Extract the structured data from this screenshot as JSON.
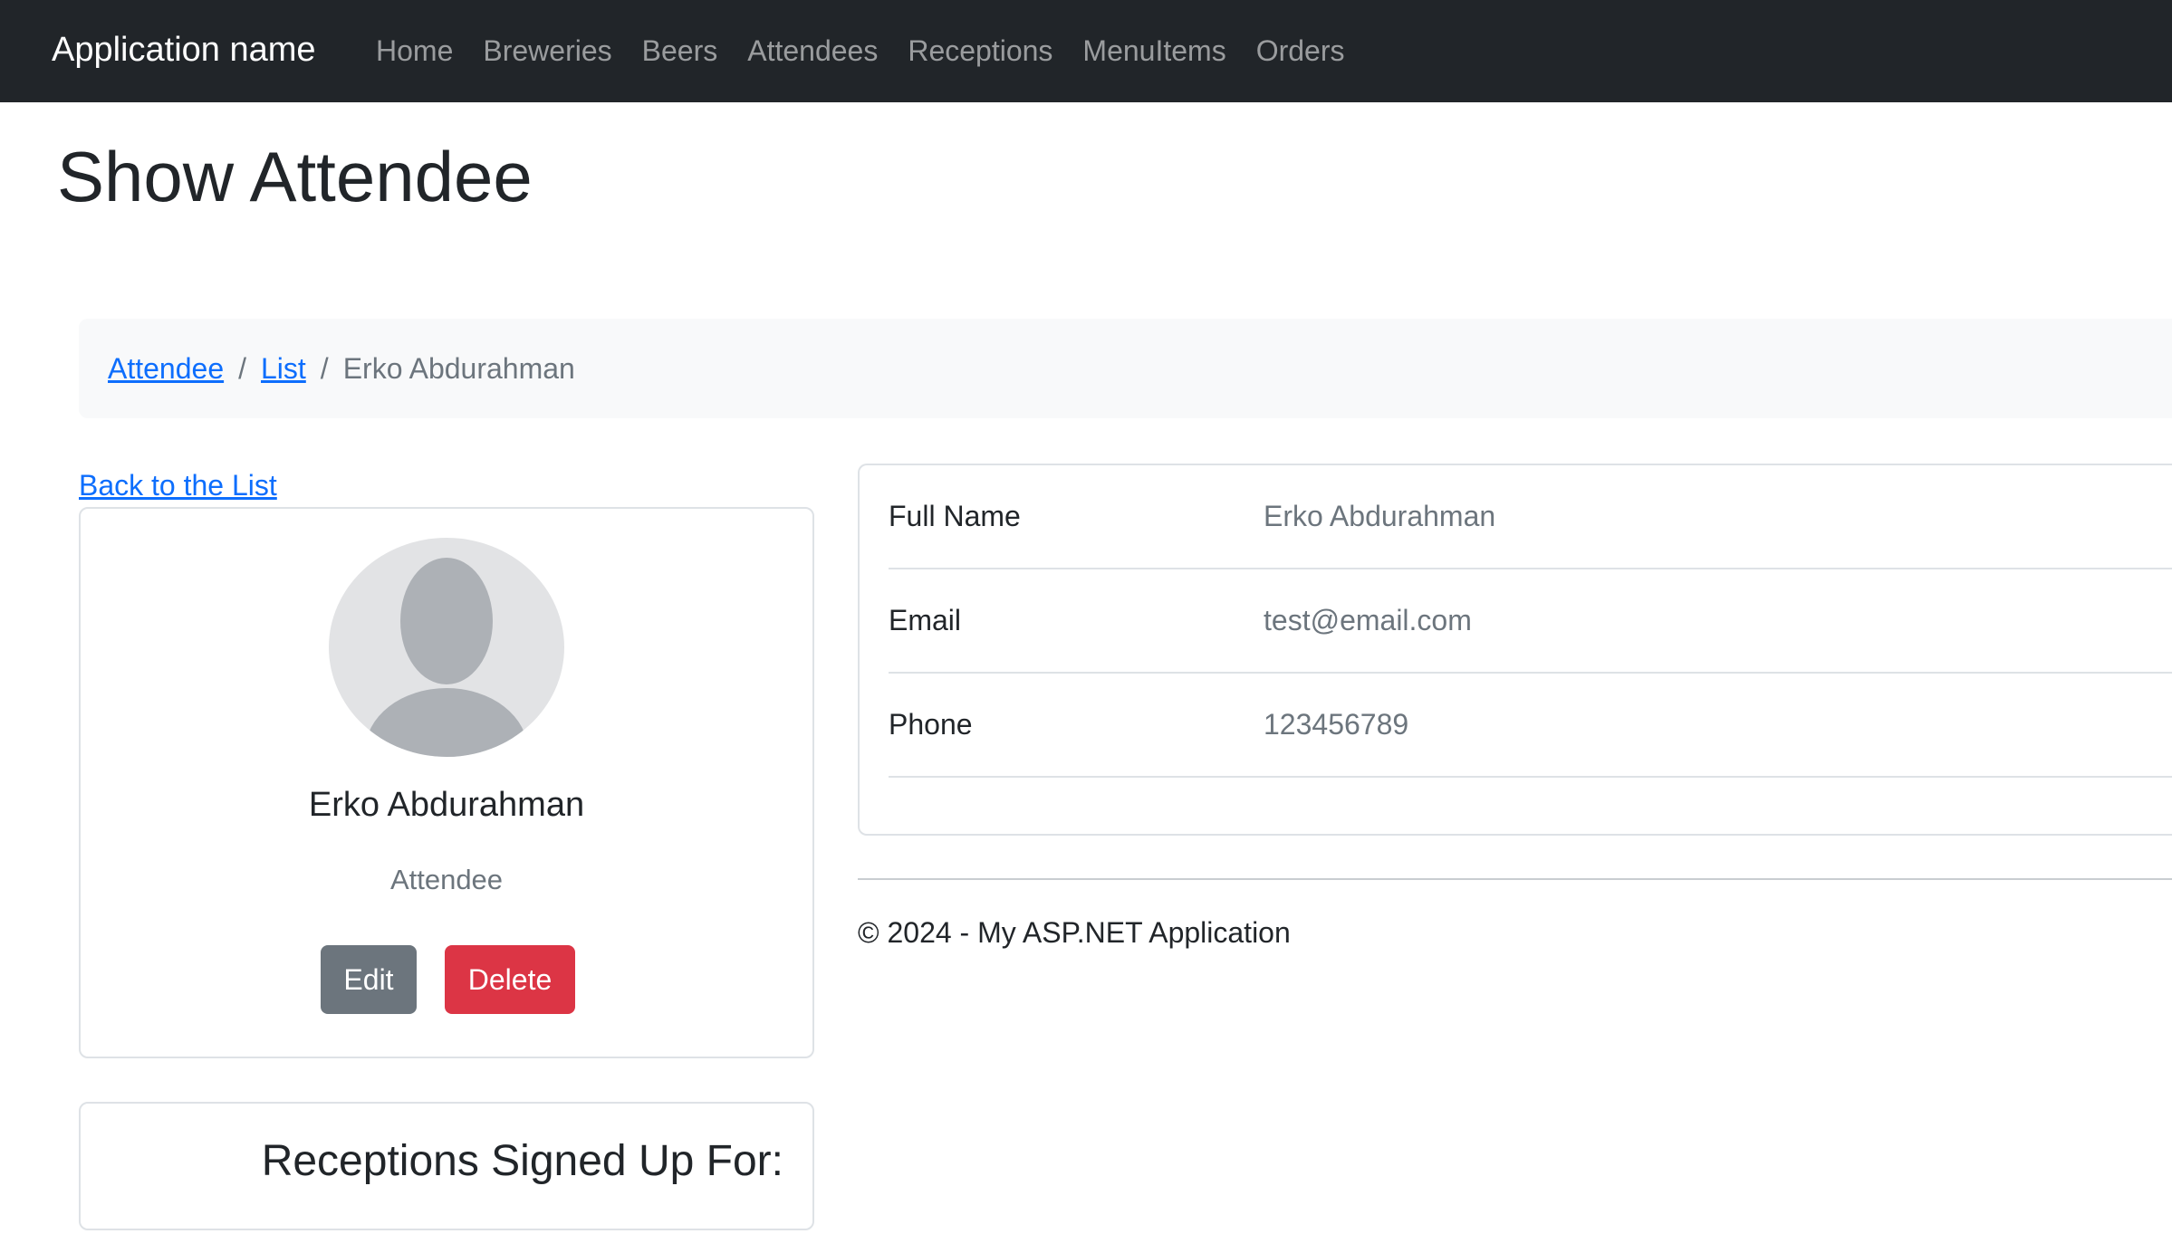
{
  "navbar": {
    "brand": "Application name",
    "items": [
      "Home",
      "Breweries",
      "Beers",
      "Attendees",
      "Receptions",
      "MenuItems",
      "Orders"
    ]
  },
  "page": {
    "title": "Show Attendee"
  },
  "breadcrumb": {
    "items": [
      "Attendee",
      "List"
    ],
    "separator": "/",
    "current": "Erko Abdurahman"
  },
  "back_link": "Back to the List",
  "profile": {
    "avatar_icon": "user-avatar-icon",
    "name": "Erko Abdurahman",
    "role": "Attendee",
    "edit_label": "Edit",
    "delete_label": "Delete"
  },
  "receptions": {
    "title": "Receptions Signed Up For:"
  },
  "details": {
    "rows": [
      {
        "label": "Full Name",
        "value": "Erko Abdurahman"
      },
      {
        "label": "Email",
        "value": "test@email.com"
      },
      {
        "label": "Phone",
        "value": "123456789"
      }
    ]
  },
  "footer": {
    "text": "© 2024 - My ASP.NET Application"
  },
  "colors": {
    "navbar_bg": "#212529",
    "link": "#0d6efd",
    "edit_button": "#6c757d",
    "delete_button": "#dc3545",
    "breadcrumb_bg": "#f8f9fa"
  }
}
